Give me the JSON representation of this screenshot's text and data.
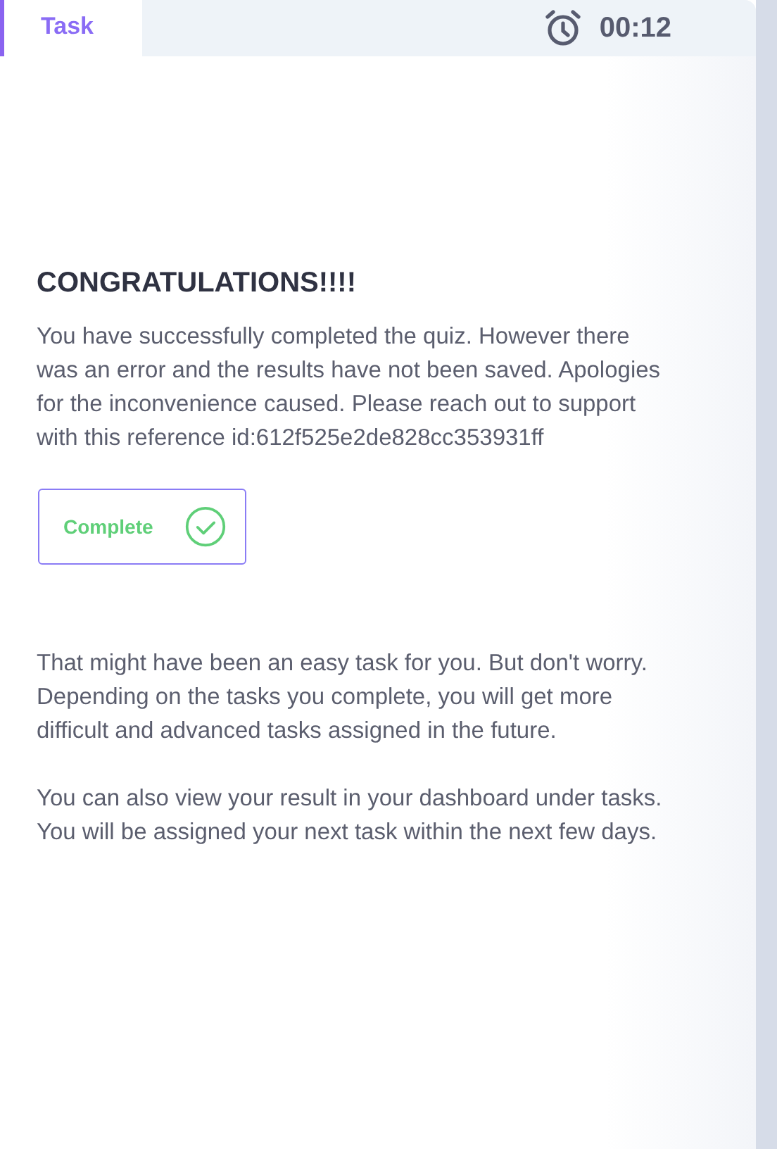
{
  "tabs": [
    {
      "label": "Task",
      "selected": true
    }
  ],
  "timer": {
    "time": "00:12"
  },
  "heading": "CONGRATULATIONS!!!!",
  "message": "You have successfully completed the quiz. However there was an error and the results have not been saved. Apologies for the inconvenience caused. Please reach out to support with this reference id:612f525e2de828cc353931ff",
  "complete_button": {
    "label": "Complete"
  },
  "paragraphs": [
    "That might have been an easy task for you. But don't worry. Depending on the tasks you complete, you will get more difficult and advanced tasks assigned in the future.",
    "You can also view your result in your dashboard under tasks. You will be assigned your next task within the next few days."
  ]
}
